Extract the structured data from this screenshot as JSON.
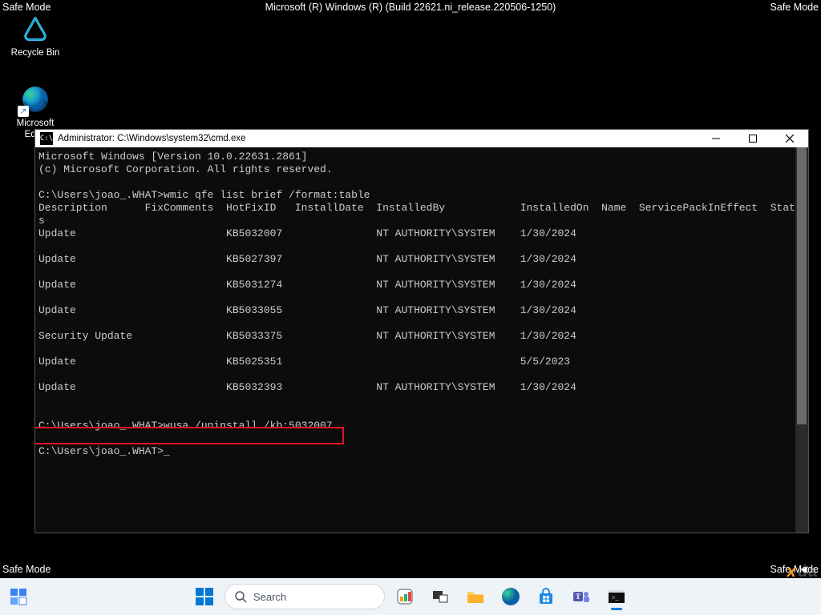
{
  "safe_mode_label": "Safe Mode",
  "build_info": "Microsoft (R) Windows (R) (Build 22621.ni_release.220506-1250)",
  "desktop": {
    "recycle_bin": "Recycle Bin",
    "edge": "Microsoft Edge"
  },
  "cmd": {
    "title": "Administrator: C:\\Windows\\system32\\cmd.exe",
    "header1": "Microsoft Windows [Version 10.0.22631.2861]",
    "header2": "(c) Microsoft Corporation. All rights reserved.",
    "prompt_path": "C:\\Users\\joao_.WHAT>",
    "cmd1": "wmic qfe list brief /format:table",
    "columns": "Description      FixComments  HotFixID   InstallDate  InstalledBy            InstalledOn  Name  ServicePackInEffect  Status",
    "rows": [
      {
        "desc": "Update",
        "kb": "KB5032007",
        "by": "NT AUTHORITY\\SYSTEM",
        "on": "1/30/2024"
      },
      {
        "desc": "Update",
        "kb": "KB5027397",
        "by": "NT AUTHORITY\\SYSTEM",
        "on": "1/30/2024"
      },
      {
        "desc": "Update",
        "kb": "KB5031274",
        "by": "NT AUTHORITY\\SYSTEM",
        "on": "1/30/2024"
      },
      {
        "desc": "Update",
        "kb": "KB5033055",
        "by": "NT AUTHORITY\\SYSTEM",
        "on": "1/30/2024"
      },
      {
        "desc": "Security Update",
        "kb": "KB5033375",
        "by": "NT AUTHORITY\\SYSTEM",
        "on": "1/30/2024"
      },
      {
        "desc": "Update",
        "kb": "KB5025351",
        "by": "",
        "on": "5/5/2023"
      },
      {
        "desc": "Update",
        "kb": "KB5032393",
        "by": "NT AUTHORITY\\SYSTEM",
        "on": "1/30/2024"
      }
    ],
    "cmd2": "wusa /uninstall /kb:5032007",
    "final_prompt": "C:\\Users\\joao_.WHAT>"
  },
  "taskbar": {
    "search_placeholder": "Search"
  },
  "watermark": "xda"
}
